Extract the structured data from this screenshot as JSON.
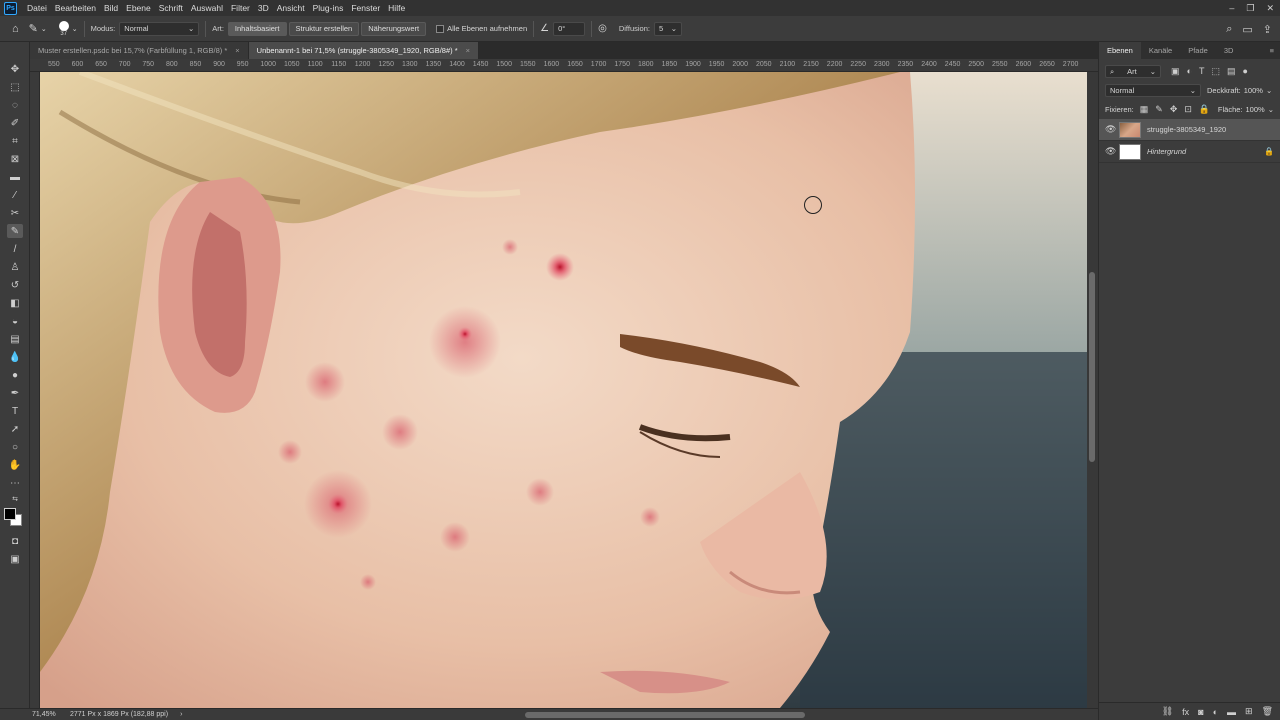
{
  "app": {
    "logo": "Ps"
  },
  "menu": [
    "Datei",
    "Bearbeiten",
    "Bild",
    "Ebene",
    "Schrift",
    "Auswahl",
    "Filter",
    "3D",
    "Ansicht",
    "Plug-ins",
    "Fenster",
    "Hilfe"
  ],
  "options": {
    "brush_size": "37",
    "mode_label": "Modus:",
    "mode_value": "Normal",
    "type_label": "Art:",
    "type_buttons": [
      "Inhaltsbasiert",
      "Struktur erstellen",
      "Näherungswert"
    ],
    "sample_all_label": "Alle Ebenen aufnehmen",
    "angle_value": "0°",
    "diffusion_label": "Diffusion:",
    "diffusion_value": "5"
  },
  "tabs": [
    {
      "label": "Muster erstellen.psdc bei 15,7% (Farbfüllung 1, RGB/8) *",
      "active": false
    },
    {
      "label": "Unbenannt-1 bei 71,5% (struggle-3805349_1920, RGB/8#) *",
      "active": true
    }
  ],
  "ruler": [
    "550",
    "600",
    "650",
    "700",
    "750",
    "800",
    "850",
    "900",
    "950",
    "1000",
    "1050",
    "1100",
    "1150",
    "1200",
    "1250",
    "1300",
    "1350",
    "1400",
    "1450",
    "1500",
    "1550",
    "1600",
    "1650",
    "1700",
    "1750",
    "1800",
    "1850",
    "1900",
    "1950",
    "2000",
    "2050",
    "2100",
    "2150",
    "2200",
    "2250",
    "2300",
    "2350",
    "2400",
    "2450",
    "2500",
    "2550",
    "2600",
    "2650",
    "2700"
  ],
  "status": {
    "zoom": "71,45%",
    "doc_info": "2771 Px x 1869 Px (182,88 ppi)"
  },
  "panel": {
    "tabs": [
      "Ebenen",
      "Kanäle",
      "Pfade",
      "3D"
    ],
    "filter_label": "Art",
    "blend_mode": "Normal",
    "opacity_label": "Deckkraft:",
    "opacity_value": "100%",
    "lock_label": "Fixieren:",
    "fill_label": "Fläche:",
    "fill_value": "100%",
    "layers": [
      {
        "name": "struggle-3805349_1920",
        "active": true
      },
      {
        "name": "Hintergrund",
        "active": false
      }
    ]
  }
}
